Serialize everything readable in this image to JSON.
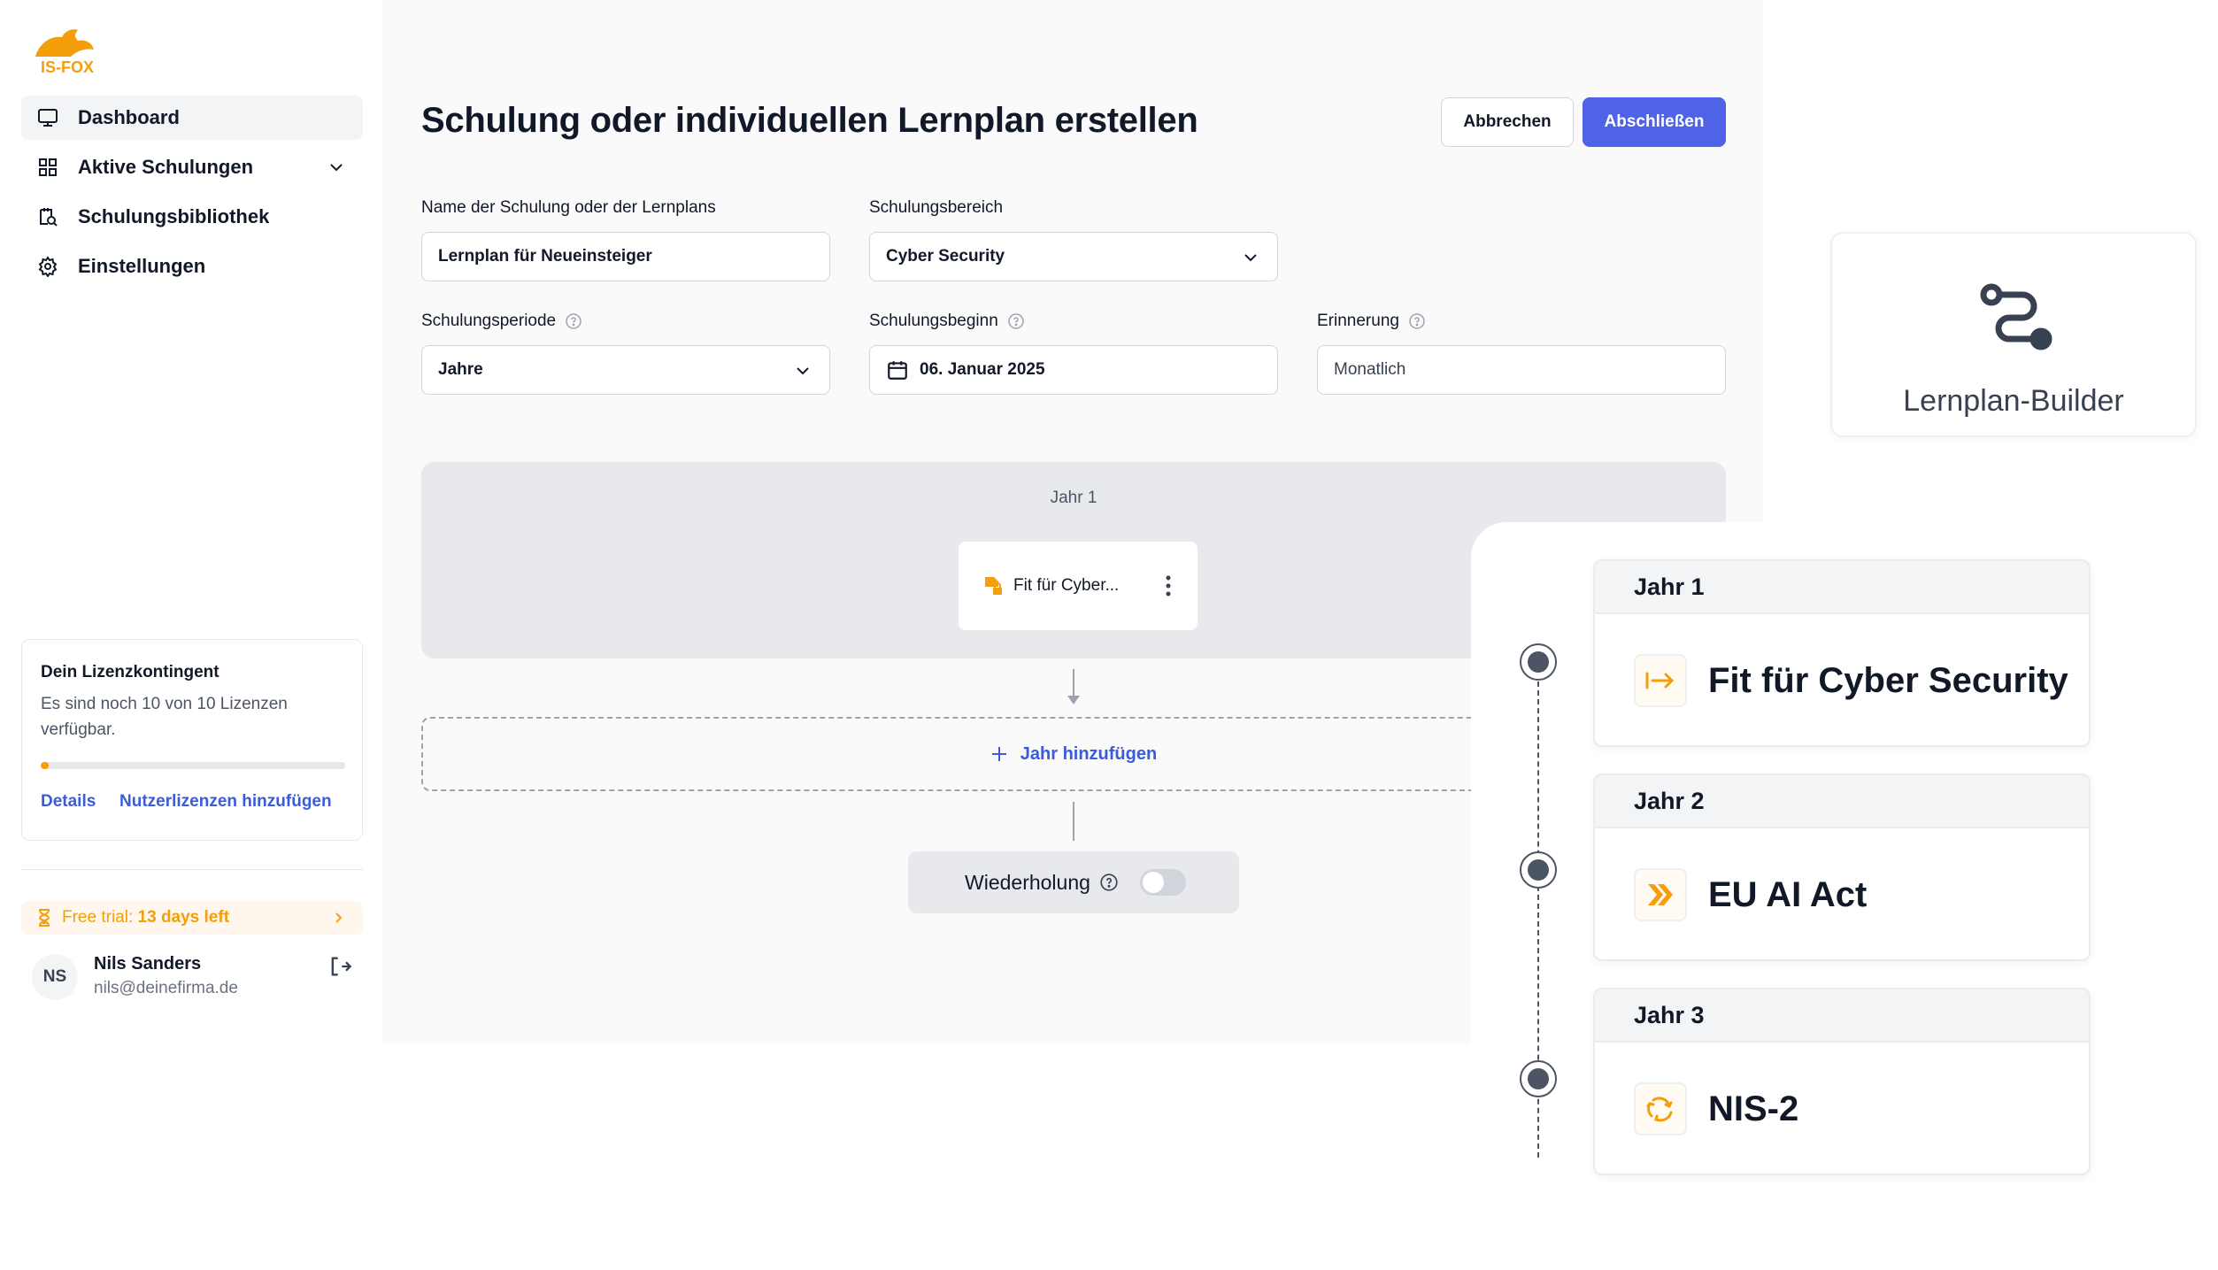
{
  "brand": {
    "logo_text": "IS-FOX",
    "accent": "#f59e0b",
    "primary": "#4f63e7"
  },
  "sidebar": {
    "items": [
      {
        "label": "Dashboard",
        "icon": "monitor-icon",
        "active": true
      },
      {
        "label": "Aktive Schulungen",
        "icon": "grid-icon",
        "expandable": true
      },
      {
        "label": "Schulungsbibliothek",
        "icon": "library-search-icon"
      },
      {
        "label": "Einstellungen",
        "icon": "gear-icon"
      }
    ],
    "license": {
      "title": "Dein Lizenzkontingent",
      "text": "Es sind noch 10 von 10 Lizenzen verfügbar.",
      "used_fraction": 0.0,
      "link_details": "Details",
      "link_add": "Nutzerlizenzen hinzufügen"
    },
    "trial": {
      "prefix": "Free trial: ",
      "days": "13 days left"
    },
    "user": {
      "initials": "NS",
      "name": "Nils Sanders",
      "email": "nils@deinefirma.de"
    }
  },
  "main": {
    "title": "Schulung oder individuellen Lernplan erstellen",
    "cancel_label": "Abbrechen",
    "finish_label": "Abschließen",
    "fields": {
      "name": {
        "label": "Name der Schulung oder der Lernplans",
        "value": "Lernplan für Neueinsteiger"
      },
      "area": {
        "label": "Schulungsbereich",
        "value": "Cyber Security"
      },
      "period": {
        "label": "Schulungsperiode",
        "value": "Jahre"
      },
      "start": {
        "label": "Schulungsbeginn",
        "value": "06. Januar 2025"
      },
      "reminder": {
        "label": "Erinnerung",
        "value": "Monatlich"
      }
    },
    "year_box": {
      "label": "Jahr 1",
      "course": "Fit für Cyber..."
    },
    "add_year_label": "Jahr hinzufügen",
    "repeat": {
      "label": "Wiederholung",
      "enabled": false
    }
  },
  "builder_card": {
    "label": "Lernplan-Builder"
  },
  "timeline": [
    {
      "year": "Jahr 1",
      "title": "Fit für Cyber Security",
      "icon": "arrow-right-bar-icon"
    },
    {
      "year": "Jahr 2",
      "title": "EU AI Act",
      "icon": "double-chevron-right-icon"
    },
    {
      "year": "Jahr 3",
      "title": "NIS-2",
      "icon": "recycle-icon"
    }
  ]
}
